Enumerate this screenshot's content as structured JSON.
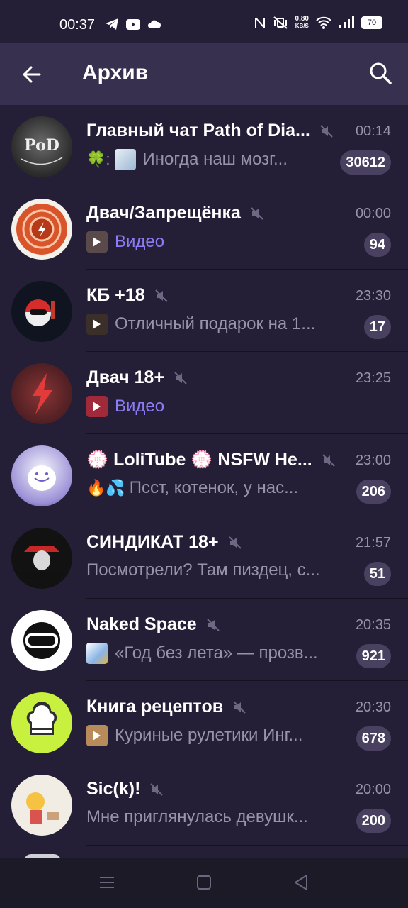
{
  "status_bar": {
    "time": "00:37",
    "speed_value": "0.80",
    "speed_unit": "KB/S",
    "battery": "70"
  },
  "header": {
    "title": "Архив"
  },
  "chats": [
    {
      "title": "Главный чат Path of Dia...",
      "time": "00:14",
      "prefix": "🍀:",
      "preview": "Иногда наш мозг...",
      "badge": "30612",
      "media": false
    },
    {
      "title": "Двач/Запрещёнка",
      "time": "00:00",
      "prefix": "",
      "preview": "Видео",
      "badge": "94",
      "media": true
    },
    {
      "title": "КБ +18",
      "time": "23:30",
      "prefix": "",
      "preview": "Отличный подарок на 1...",
      "badge": "17",
      "media": false
    },
    {
      "title": "Двач 18+",
      "time": "23:25",
      "prefix": "",
      "preview": "Видео",
      "badge": "",
      "media": true
    },
    {
      "title": "💮 LoliTube 💮 NSFW He...",
      "time": "23:00",
      "prefix": "🔥💦",
      "preview": "Псст, котенок, у нас...",
      "badge": "206",
      "media": false
    },
    {
      "title": "СИНДИКАТ 18+",
      "time": "21:57",
      "prefix": "",
      "preview": "Посмотрели? Там пиздец, с...",
      "badge": "51",
      "media": false
    },
    {
      "title": "Naked Space",
      "time": "20:35",
      "prefix": "",
      "preview": "«Год без лета» — прозв...",
      "badge": "921",
      "media": false
    },
    {
      "title": "Книга рецептов",
      "time": "20:30",
      "prefix": "",
      "preview": "Куриные рулетики Инг...",
      "badge": "678",
      "media": false
    },
    {
      "title": "Sic(k)!",
      "time": "20:00",
      "prefix": "",
      "preview": "Мне приглянулась девушк...",
      "badge": "200",
      "media": false
    }
  ]
}
